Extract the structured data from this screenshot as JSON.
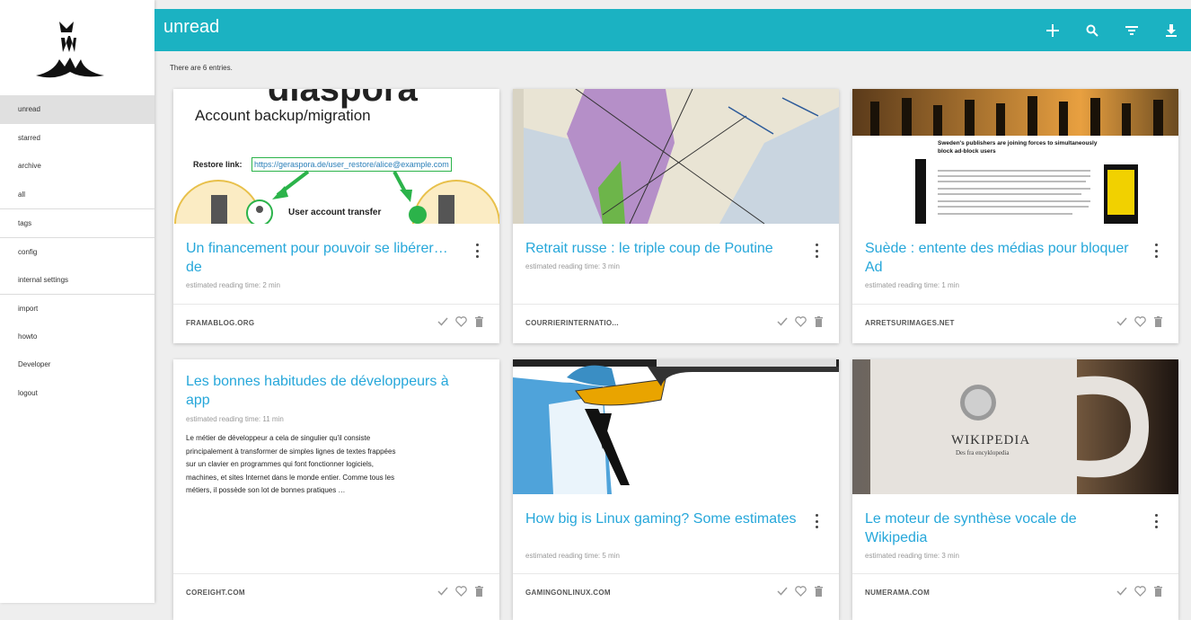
{
  "sidebar": {
    "items": [
      {
        "label": "unread"
      },
      {
        "label": "starred"
      },
      {
        "label": "archive"
      },
      {
        "label": "all"
      },
      {
        "label": "tags"
      },
      {
        "label": "config"
      },
      {
        "label": "internal settings"
      },
      {
        "label": "import"
      },
      {
        "label": "howto"
      },
      {
        "label": "Developer"
      },
      {
        "label": "logout"
      }
    ],
    "active": "unread"
  },
  "header": {
    "title": "unread",
    "actions": [
      "add-icon",
      "search-icon",
      "filter-icon",
      "download-icon"
    ]
  },
  "entries_count_text": "There are 6 entries.",
  "cards": [
    {
      "title": "Un financement pour pouvoir se libérer… de",
      "reading_time": "estimated reading time: 2 min",
      "domain": "FRAMABLOG.ORG",
      "image": {
        "heading": "diaspora",
        "subheading": "Account backup/migration",
        "restore_label": "Restore link:",
        "restore_url": "https://geraspora.de/user_restore/alice@example.com",
        "transfer_label": "User account transfer"
      }
    },
    {
      "title": "Retrait russe : le triple coup de Poutine",
      "reading_time": "estimated reading time: 3 min",
      "domain": "COURRIERINTERNATIO..."
    },
    {
      "title": "Suède : entente des médias pour bloquer Ad",
      "reading_time": "estimated reading time: 1 min",
      "domain": "ARRETSURIMAGES.NET",
      "image": {
        "headline": "Sweden's publishers are joining forces to simultaneously block ad-block users"
      }
    },
    {
      "title": "Les bonnes habitudes de développeurs à app",
      "reading_time": "estimated reading time: 11 min",
      "domain": "COREIGHT.COM",
      "excerpt": [
        "Le métier de développeur a cela de singulier qu'il consiste",
        "principalement à transformer de simples lignes de textes frappées",
        "sur un clavier en programmes qui font fonctionner logiciels,",
        "machines, et sites Internet dans le monde entier. Comme tous les",
        "métiers, il possède son lot de bonnes pratiques …"
      ]
    },
    {
      "title": "How big is Linux gaming? Some estimates",
      "reading_time": "estimated reading time: 5 min",
      "domain": "GAMINGONLINUX.COM"
    },
    {
      "title": "Le moteur de synthèse vocale de Wikipedia",
      "reading_time": "estimated reading time: 3 min",
      "domain": "NUMERAMA.COM",
      "image": {
        "mug_text": "WIKIPEDIA",
        "mug_subtext": "Des fra encyklopedia"
      }
    }
  ],
  "colors": {
    "accent": "#1bb2c2",
    "link": "#26a7da",
    "background": "#eeeeee"
  }
}
